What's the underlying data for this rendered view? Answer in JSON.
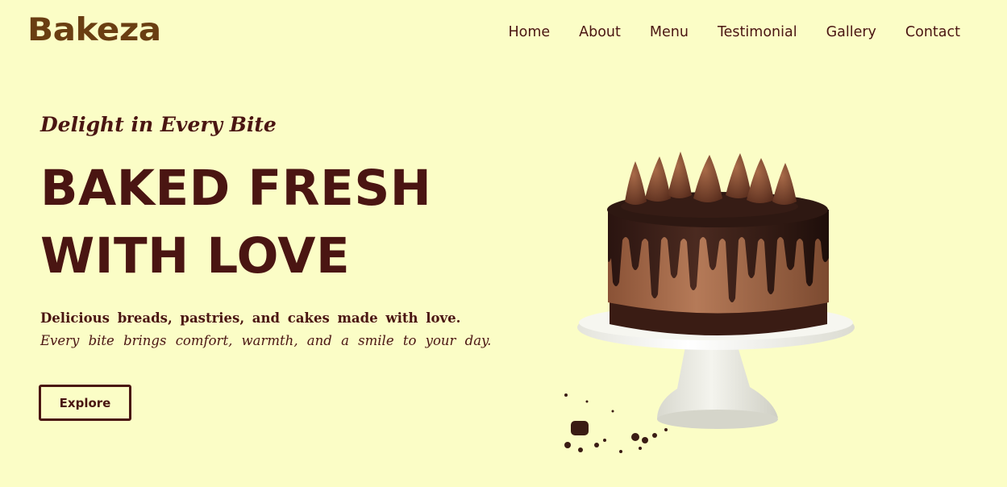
{
  "header": {
    "logo": "Bakeza",
    "nav": [
      "Home",
      "About",
      "Menu",
      "Testimonial",
      "Gallery",
      "Contact"
    ]
  },
  "hero": {
    "tagline": "Delight in Every Bite",
    "headline_line1": "BAKED FRESH",
    "headline_line2": "WITH LOVE",
    "description_line1": "Delicious breads, pastries, and cakes made with love.",
    "description_line2": "Every bite brings comfort, warmth, and a smile to your day.",
    "button_label": "Explore"
  },
  "image": {
    "subject": "chocolate-drip-cake-on-stand"
  },
  "colors": {
    "background": "#fbfdc6",
    "primary_text": "#4a1512",
    "logo": "#6a3e12"
  }
}
